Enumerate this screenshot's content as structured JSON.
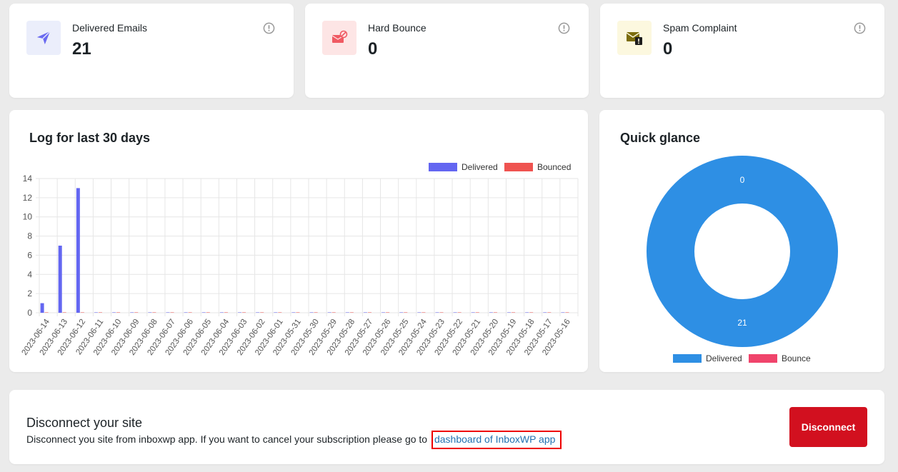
{
  "stats": [
    {
      "label": "Delivered Emails",
      "value": "21",
      "icon": "paper-plane-icon",
      "icon_bg": "#ebeefb",
      "icon_color": "#6a6af0"
    },
    {
      "label": "Hard Bounce",
      "value": "0",
      "icon": "mail-blocked-icon",
      "icon_bg": "#fde5e5",
      "icon_color": "#f05a63"
    },
    {
      "label": "Spam Complaint",
      "value": "0",
      "icon": "mail-warning-icon",
      "icon_bg": "#fcf8df",
      "icon_color": "#7c6d0c"
    }
  ],
  "log": {
    "title": "Log for last 30 days"
  },
  "glance": {
    "title": "Quick glance"
  },
  "chart_data": [
    {
      "type": "bar",
      "categories": [
        "2023-06-14",
        "2023-06-13",
        "2023-06-12",
        "2023-06-11",
        "2023-06-10",
        "2023-06-09",
        "2023-06-08",
        "2023-06-07",
        "2023-06-06",
        "2023-06-05",
        "2023-06-04",
        "2023-06-03",
        "2023-06-02",
        "2023-06-01",
        "2023-05-31",
        "2023-05-30",
        "2023-05-29",
        "2023-05-28",
        "2023-05-27",
        "2023-05-26",
        "2023-05-25",
        "2023-05-24",
        "2023-05-23",
        "2023-05-22",
        "2023-05-21",
        "2023-05-20",
        "2023-05-19",
        "2023-05-18",
        "2023-05-17",
        "2023-05-16"
      ],
      "series": [
        {
          "name": "Delivered",
          "color": "#6366f1",
          "values": [
            1,
            7,
            13,
            0,
            0,
            0,
            0,
            0,
            0,
            0,
            0,
            0,
            0,
            0,
            0,
            0,
            0,
            0,
            0,
            0,
            0,
            0,
            0,
            0,
            0,
            0,
            0,
            0,
            0,
            0
          ]
        },
        {
          "name": "Bounced",
          "color": "#ef5350",
          "values": [
            0,
            0,
            0,
            0,
            0,
            0,
            0,
            0,
            0,
            0,
            0,
            0,
            0,
            0,
            0,
            0,
            0,
            0,
            0,
            0,
            0,
            0,
            0,
            0,
            0,
            0,
            0,
            0,
            0,
            0
          ]
        }
      ],
      "yticks": [
        "0",
        "2",
        "4",
        "6",
        "8",
        "10",
        "12",
        "14"
      ],
      "ylim": [
        0,
        14
      ],
      "grid": true,
      "legend_position": "top-right"
    },
    {
      "type": "pie",
      "categories": [
        "Delivered",
        "Bounce"
      ],
      "values": [
        21,
        0
      ],
      "labels": [
        "21",
        "0"
      ],
      "colors": [
        "#2e8fe4",
        "#f0446b"
      ],
      "legend_position": "bottom"
    }
  ],
  "disconnect": {
    "title": "Disconnect your site",
    "text": "Disconnect you site from inboxwp app. If you want to cancel your subscription please go to",
    "link": "dashboard of InboxWP app",
    "button": "Disconnect"
  }
}
